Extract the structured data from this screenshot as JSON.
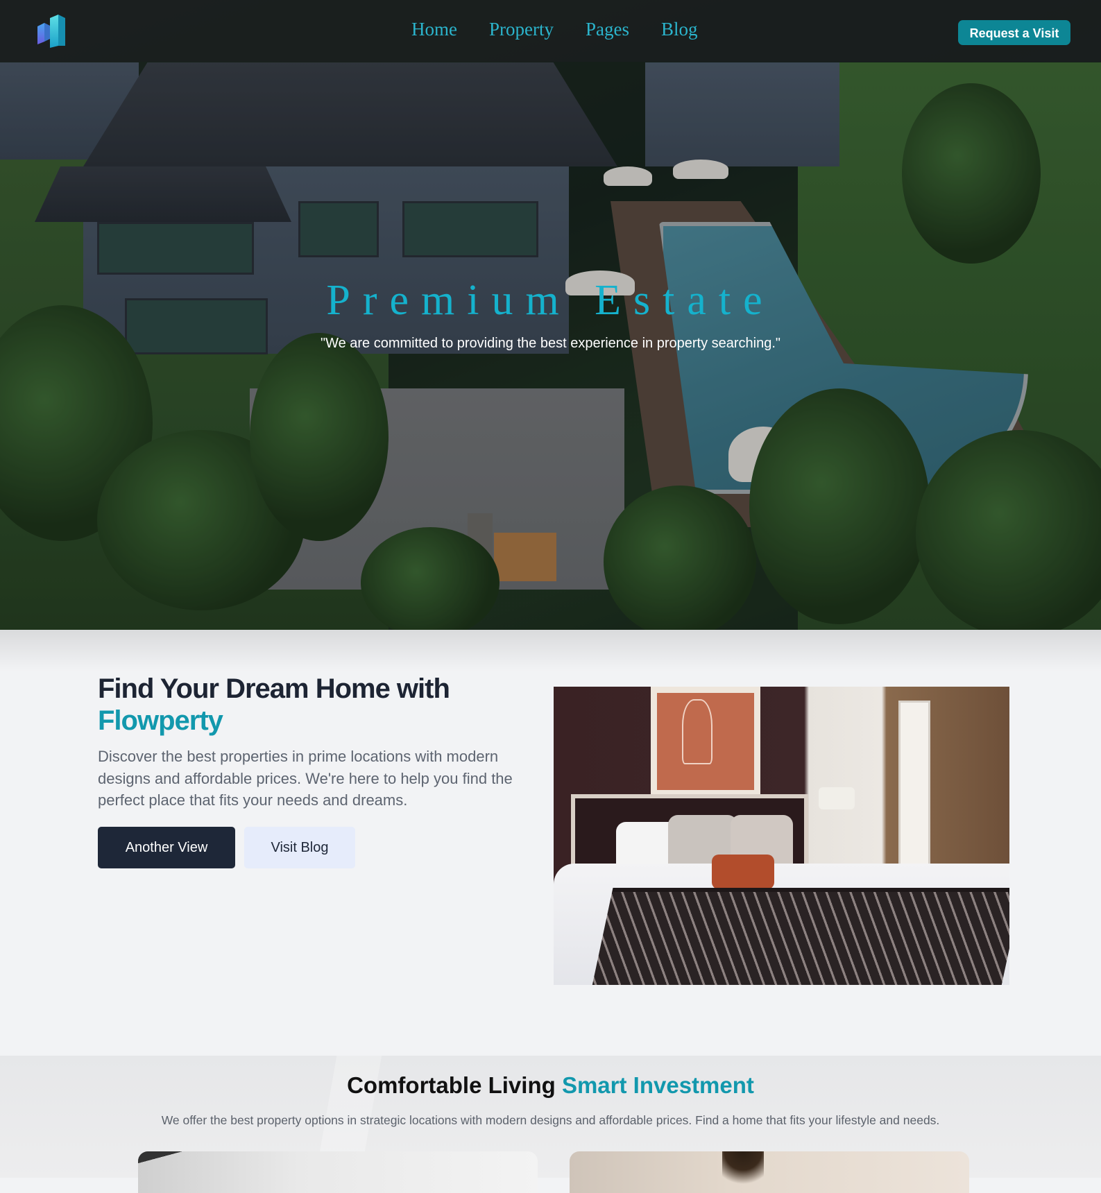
{
  "nav": {
    "links": [
      "Home",
      "Property",
      "Pages",
      "Blog"
    ],
    "cta_label": "Request a Visit"
  },
  "hero": {
    "title": "Premium Estate",
    "subtitle": "\"We are committed to providing the best experience in property searching.\""
  },
  "feature": {
    "heading_line1": "Find Your Dream Home with",
    "heading_accent": "Flowperty",
    "paragraph": "Discover the best properties in prime locations with modern designs and affordable prices. We're here to help you find the perfect place that fits your needs and dreams.",
    "primary_button": "Another View",
    "secondary_button": "Visit Blog"
  },
  "living": {
    "heading_plain": "Comfortable Living",
    "heading_accent": "Smart Investment",
    "paragraph": "We offer the best property options in strategic locations with modern designs and affordable prices. Find a home that fits your lifestyle and needs."
  },
  "colors": {
    "accent": "#1298ad",
    "cta": "#0d8695",
    "dark_button": "#1e2738",
    "light_button": "#e6ecfb",
    "nav_link": "#2bb4cc"
  },
  "icons": {
    "logo": "building-logo-icon"
  }
}
